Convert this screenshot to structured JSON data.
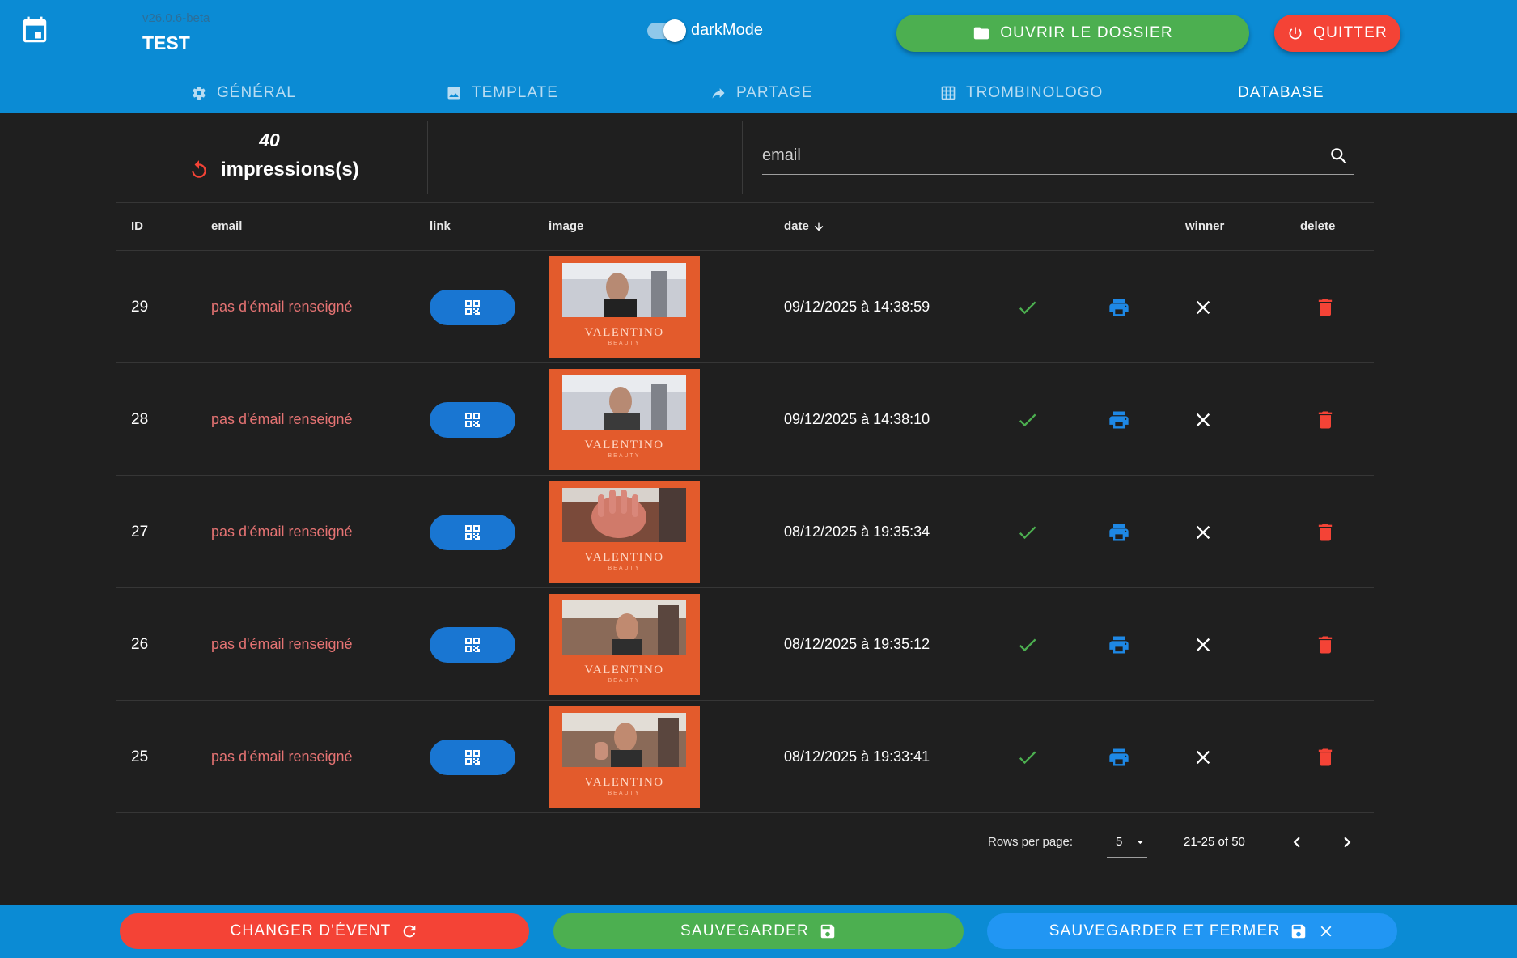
{
  "header": {
    "version": "v26.0.6-beta",
    "event_name": "TEST",
    "dark_mode_label": "darkMode",
    "open_folder_label": "OUVRIR LE DOSSIER",
    "quit_label": "QUITTER",
    "colors": {
      "app_bar": "#0b8bd4",
      "open": "#4caf50",
      "quit": "#f44336"
    }
  },
  "tabs": [
    {
      "label": "GÉNÉRAL",
      "icon": "gear-icon"
    },
    {
      "label": "TEMPLATE",
      "icon": "image-icon"
    },
    {
      "label": "PARTAGE",
      "icon": "share-icon"
    },
    {
      "label": "TROMBINOLOGO",
      "icon": "grid-icon"
    },
    {
      "label": "DATABASE",
      "icon": "",
      "active": true
    }
  ],
  "stats": {
    "count": "40",
    "label": "impressions(s)"
  },
  "search": {
    "placeholder": "email"
  },
  "table": {
    "columns": {
      "id": "ID",
      "email": "email",
      "link": "link",
      "image": "image",
      "date": "date",
      "winner": "winner",
      "delete": "delete"
    },
    "rows": [
      {
        "id": "29",
        "email": "pas d'émail renseigné",
        "date": "09/12/2025 à 14:38:59",
        "brand": "VALENTINO",
        "brand_sub": "BEAUTY"
      },
      {
        "id": "28",
        "email": "pas d'émail renseigné",
        "date": "09/12/2025 à 14:38:10",
        "brand": "VALENTINO",
        "brand_sub": "BEAUTY"
      },
      {
        "id": "27",
        "email": "pas d'émail renseigné",
        "date": "08/12/2025 à 19:35:34",
        "brand": "VALENTINO",
        "brand_sub": "BEAUTY"
      },
      {
        "id": "26",
        "email": "pas d'émail renseigné",
        "date": "08/12/2025 à 19:35:12",
        "brand": "VALENTINO",
        "brand_sub": "BEAUTY"
      },
      {
        "id": "25",
        "email": "pas d'émail renseigné",
        "date": "08/12/2025 à 19:33:41",
        "brand": "VALENTINO",
        "brand_sub": "BEAUTY"
      }
    ]
  },
  "pagination": {
    "rows_per_page_label": "Rows per page:",
    "rows_per_page": "5",
    "range": "21-25 of 50"
  },
  "footer": {
    "change_event_label": "CHANGER D'ÉVENT",
    "save_label": "SAUVEGARDER",
    "save_close_label": "SAUVEGARDER ET FERMER"
  }
}
